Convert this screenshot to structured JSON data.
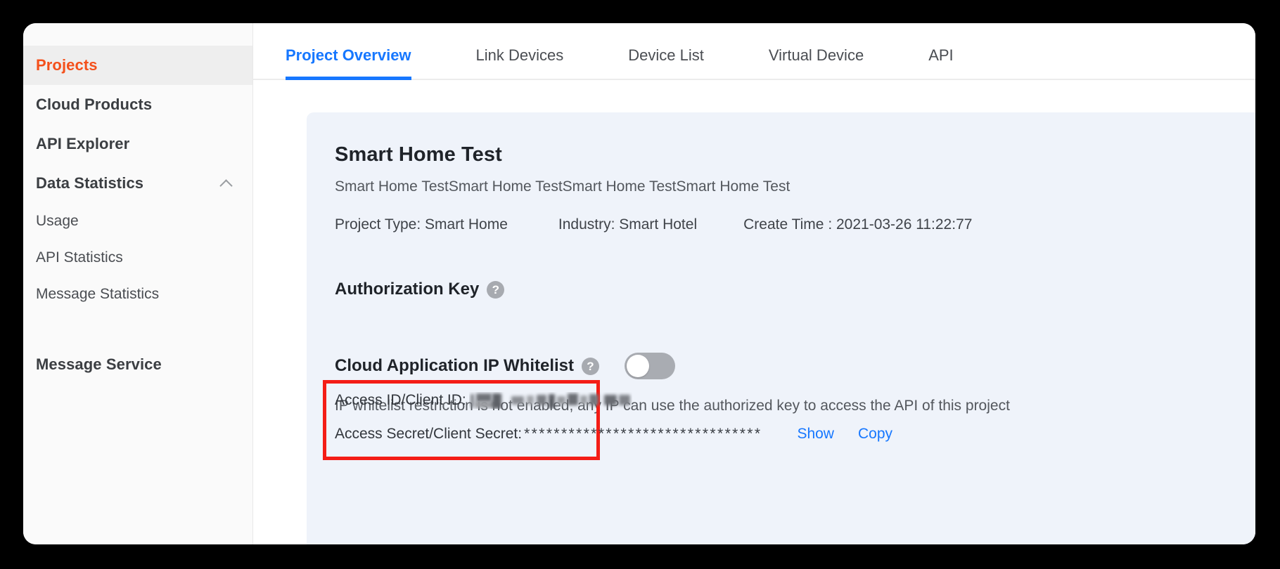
{
  "sidebar": {
    "items": [
      {
        "label": "Projects",
        "type": "item",
        "active": true
      },
      {
        "label": "Cloud Products",
        "type": "item",
        "active": false
      },
      {
        "label": "API Explorer",
        "type": "item",
        "active": false
      },
      {
        "label": "Data Statistics",
        "type": "group",
        "expanded": true
      },
      {
        "label": "Usage",
        "type": "sub"
      },
      {
        "label": "API Statistics",
        "type": "sub"
      },
      {
        "label": "Message Statistics",
        "type": "sub"
      },
      {
        "label": "Message Service",
        "type": "item",
        "active": false
      }
    ],
    "active_color": "#f4501b"
  },
  "tabs": [
    {
      "label": "Project Overview",
      "active": true
    },
    {
      "label": "Link Devices",
      "active": false
    },
    {
      "label": "Device List",
      "active": false
    },
    {
      "label": "Virtual Device",
      "active": false
    },
    {
      "label": "API",
      "active": false
    }
  ],
  "tab_accent": "#1677ff",
  "project": {
    "title": "Smart Home Test",
    "description": "Smart Home TestSmart Home TestSmart Home TestSmart Home Test",
    "project_type": "Project Type: Smart Home",
    "industry": "Industry: Smart Hotel",
    "create_time": "Create Time : 2021-03-26 11:22:77"
  },
  "authorization": {
    "section_title": "Authorization Key",
    "help_glyph": "?",
    "access_id_label": "Access ID/Client ID:",
    "access_id_value": "",
    "access_secret_label": "Access Secret/Client Secret:",
    "access_secret_masked": "********************************",
    "show_label": "Show",
    "copy_label": "Copy",
    "highlight_color": "#f41d16"
  },
  "whitelist": {
    "title": "Cloud Application IP Whitelist",
    "help_glyph": "?",
    "enabled": false,
    "note": "IP whitelist restriction is not enabled, any IP can use the authorized key to access the API of this project"
  }
}
